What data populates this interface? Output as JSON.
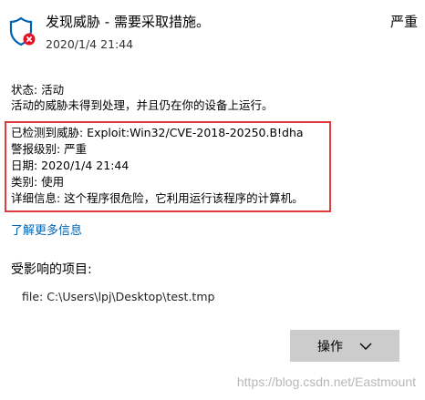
{
  "threat": {
    "title": "发现威胁 - 需要采取措施。",
    "date": "2020/1/4 21:44",
    "severity": "严重",
    "icon": "shield-alert-icon"
  },
  "status": {
    "line1": "状态: 活动",
    "line2": "活动的威胁未得到处理，并且仍在你的设备上运行。"
  },
  "details": {
    "detected": "已检测到威胁: Exploit:Win32/CVE-2018-20250.B!dha",
    "alert_level": "警报级别: 严重",
    "date": "日期: 2020/1/4 21:44",
    "category": "类别: 使用",
    "description": "详细信息: 这个程序很危险，它利用运行该程序的计算机。"
  },
  "learn_more": "了解更多信息",
  "affected": {
    "heading": "受影响的项目:",
    "items": [
      "file: C:\\Users\\lpj\\Desktop\\test.tmp"
    ]
  },
  "actions": {
    "label": "操作"
  },
  "watermark": "https://blog.csdn.net/Eastmount",
  "colors": {
    "highlight_border": "#e0393e",
    "link": "#0063b1",
    "button_bg": "#cccccc",
    "shield": "#0063b1",
    "alert_badge": "#e81123"
  }
}
